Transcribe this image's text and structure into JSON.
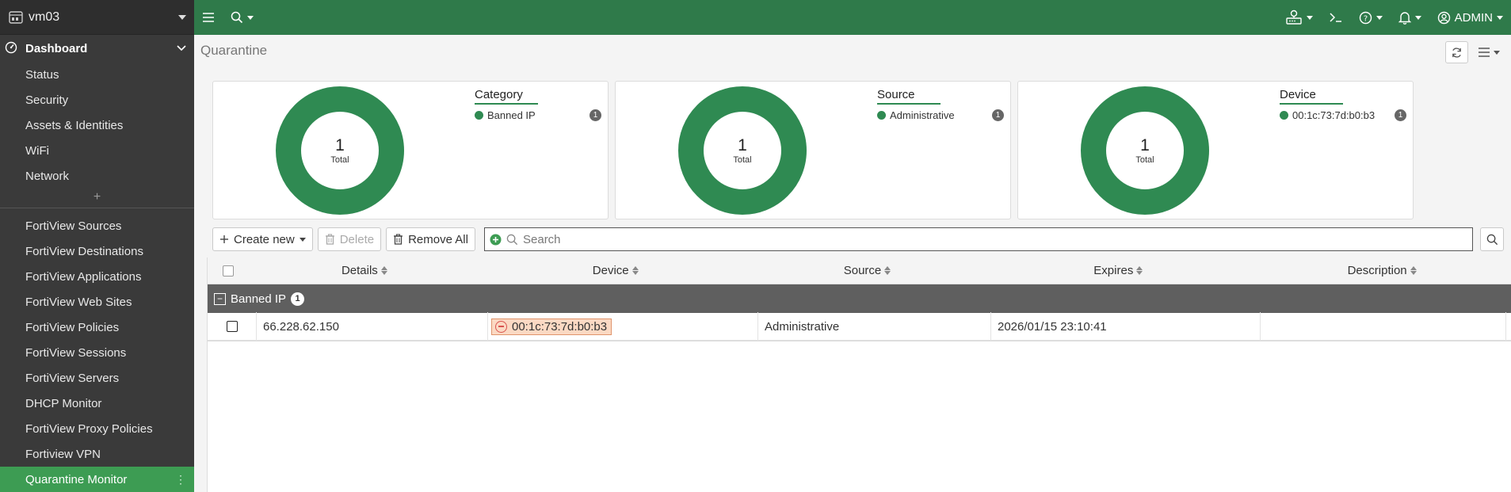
{
  "sidebar": {
    "device_name": "vm03",
    "dashboard_label": "Dashboard",
    "dashboard_items": [
      "Status",
      "Security",
      "Assets & Identities",
      "WiFi",
      "Network"
    ],
    "add_symbol": "+",
    "monitor_items": [
      "FortiView Sources",
      "FortiView Destinations",
      "FortiView Applications",
      "FortiView Web Sites",
      "FortiView Policies",
      "FortiView Sessions",
      "FortiView Servers",
      "DHCP Monitor",
      "FortiView Proxy Policies",
      "Fortiview VPN"
    ],
    "active_item": "Quarantine Monitor"
  },
  "topbar": {
    "admin_label": "ADMIN",
    "icons": [
      "menu-icon",
      "search-icon",
      "fabric-icon",
      "cli-icon",
      "help-icon",
      "bell-icon",
      "user-icon"
    ]
  },
  "page": {
    "title": "Quarantine"
  },
  "cards": [
    {
      "legend_title": "Category",
      "item": "Banned IP",
      "count": "1",
      "total": "1",
      "total_label": "Total"
    },
    {
      "legend_title": "Source",
      "item": "Administrative",
      "count": "1",
      "total": "1",
      "total_label": "Total"
    },
    {
      "legend_title": "Device",
      "item": "00:1c:73:7d:b0:b3",
      "count": "1",
      "total": "1",
      "total_label": "Total"
    }
  ],
  "toolbar": {
    "create_new": "Create new",
    "delete": "Delete",
    "remove_all": "Remove All",
    "search_placeholder": "Search"
  },
  "table": {
    "columns": [
      "Details",
      "Device",
      "Source",
      "Expires",
      "Description"
    ],
    "group": {
      "label": "Banned IP",
      "count": "1"
    },
    "rows": [
      {
        "details": "66.228.62.150",
        "device": "00:1c:73:7d:b0:b3",
        "source": "Administrative",
        "expires": "2026/01/15 23:10:41",
        "description": ""
      }
    ]
  },
  "colors": {
    "brand_green": "#2f7a4a",
    "donut_green": "#2f8a52",
    "active_green": "#3d9c53",
    "sidebar_bg": "#3a3a3a",
    "device_chip_bg": "#fbd9c3"
  }
}
